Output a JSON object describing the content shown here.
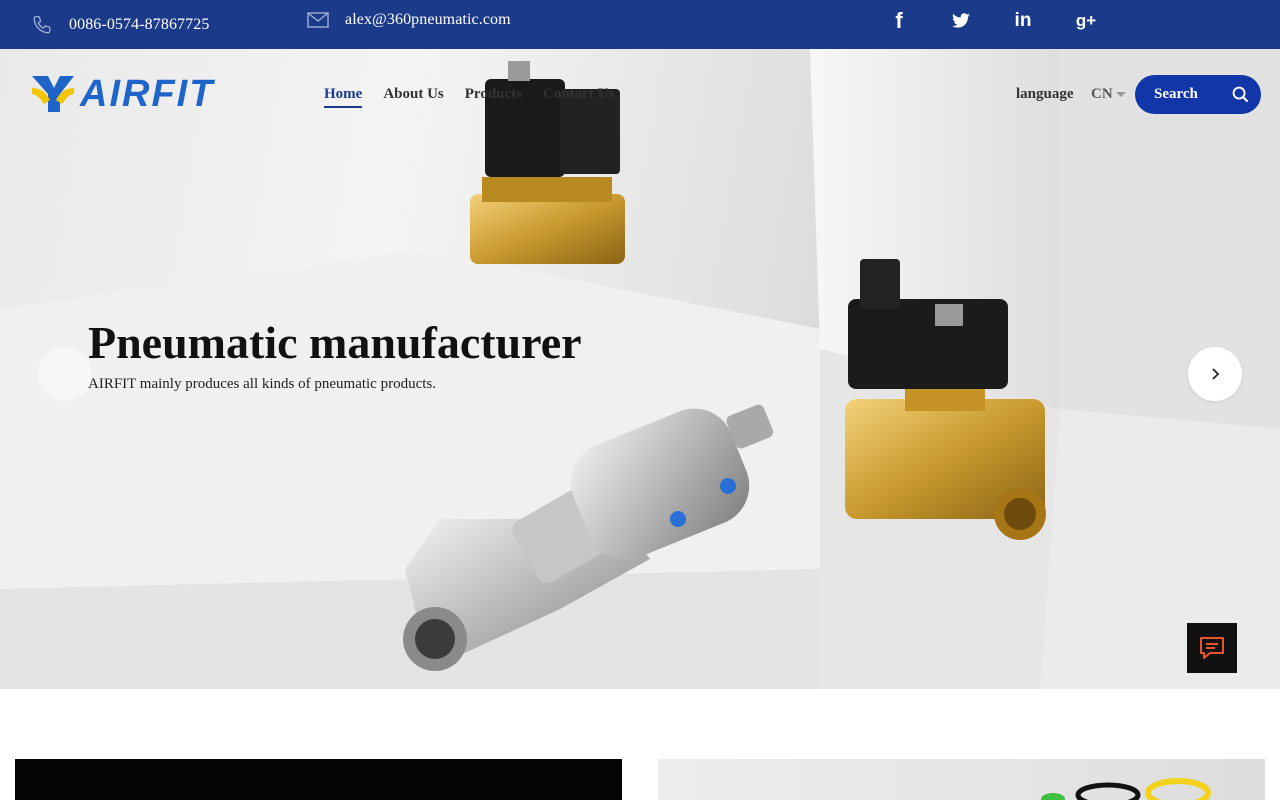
{
  "topbar": {
    "phone": "0086-0574-87867725",
    "email": "alex@360pneumatic.com",
    "social": [
      "facebook-icon",
      "twitter-icon",
      "linkedin-icon",
      "google-plus-icon"
    ],
    "social_glyphs": {
      "facebook": "f",
      "linkedin": "in",
      "googleplus": "g+"
    }
  },
  "header": {
    "logo_text": "AIRFIT",
    "nav": [
      "Home",
      "About Us",
      "Products",
      "Contact Us"
    ],
    "language_label": "language",
    "language_value": "CN",
    "search_label": "Search"
  },
  "hero": {
    "title": "Pneumatic manufacturer",
    "subtitle": "AIRFIT mainly produces all kinds of pneumatic products."
  },
  "colors": {
    "topbar": "#1c3a8a",
    "accent": "#1136a8",
    "logo_blue": "#1f64c8",
    "logo_yellow": "#f5c400",
    "chat_icon": "#e8552b"
  }
}
